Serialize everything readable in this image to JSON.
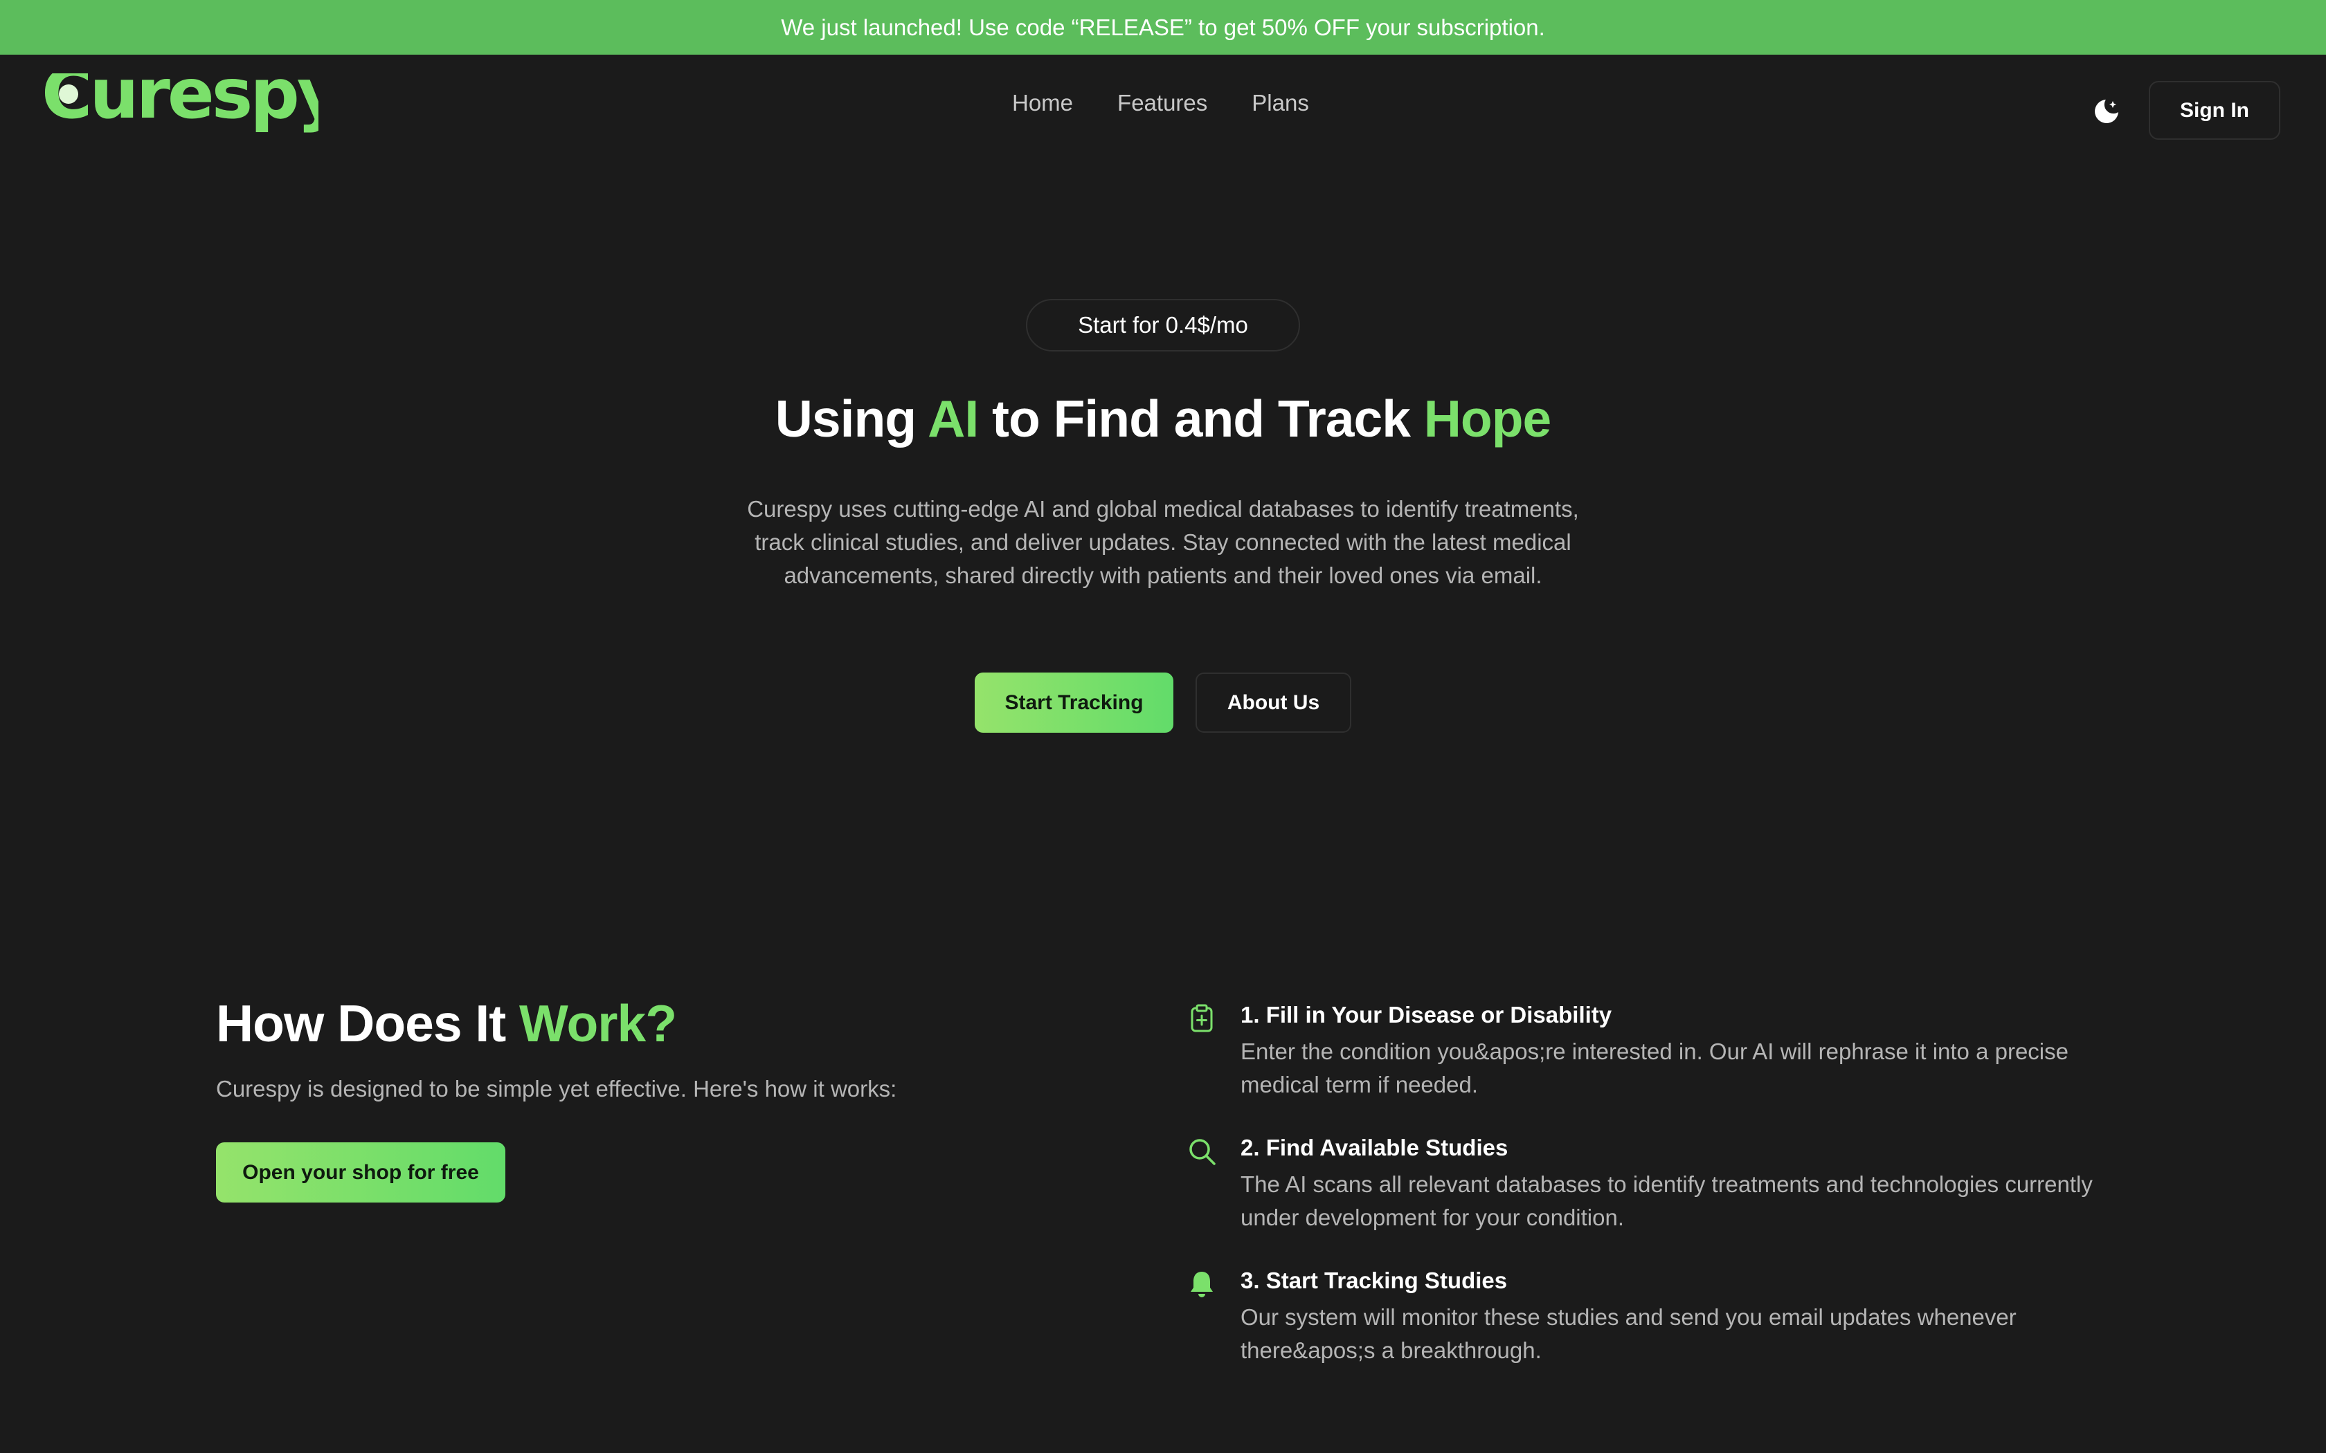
{
  "banner": {
    "text": "We just launched! Use code “RELEASE” to get 50% OFF your subscription."
  },
  "header": {
    "logo_text": "Curespy",
    "nav": [
      "Home",
      "Features",
      "Plans"
    ],
    "theme_icon": "moon-icon",
    "signin_label": "Sign In"
  },
  "hero": {
    "pill": "Start for 0.4$/mo",
    "title_parts": [
      "Using ",
      "AI",
      " to Find and Track ",
      "Hope"
    ],
    "description": "Curespy uses cutting-edge AI and global medical databases to identify treatments, track clinical studies, and deliver updates. Stay connected with the latest medical advancements, shared directly with patients and their loved ones via email.",
    "primary_button": "Start Tracking",
    "secondary_button": "About Us"
  },
  "how": {
    "title_parts": [
      "How Does It ",
      "Work?"
    ],
    "subtitle": "Curespy is designed to be simple yet effective. Here's how it works:",
    "button": "Open your shop for free",
    "steps": [
      {
        "icon": "clipboard-plus-icon",
        "title": "1. Fill in Your Disease or Disability",
        "description": "Enter the condition you&apos;re interested in. Our AI will rephrase it into a precise medical term if needed."
      },
      {
        "icon": "search-icon",
        "title": "2. Find Available Studies",
        "description": "The AI scans all relevant databases to identify treatments and technologies currently under development for your condition."
      },
      {
        "icon": "bell-icon",
        "title": "3. Start Tracking Studies",
        "description": "Our system will monitor these studies and send you email updates whenever there&apos;s a breakthrough."
      }
    ]
  },
  "colors": {
    "banner": "#5cbd5c",
    "accent": "#7be06b",
    "background": "#1b1b1b",
    "muted_text": "#b5b5b5"
  }
}
